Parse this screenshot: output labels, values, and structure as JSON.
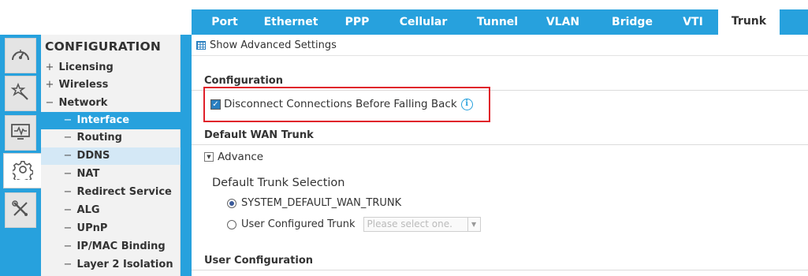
{
  "tabs": [
    {
      "label": "Port",
      "active": false
    },
    {
      "label": "Ethernet",
      "active": false
    },
    {
      "label": "PPP",
      "active": false
    },
    {
      "label": "Cellular",
      "active": false
    },
    {
      "label": "Tunnel",
      "active": false
    },
    {
      "label": "VLAN",
      "active": false
    },
    {
      "label": "Bridge",
      "active": false
    },
    {
      "label": "VTI",
      "active": false
    },
    {
      "label": "Trunk",
      "active": true
    }
  ],
  "rail": {
    "icons": [
      "dashboard-icon",
      "monitor-wand-icon",
      "activity-monitor-icon",
      "configuration-gear-icon",
      "maintenance-tools-icon"
    ],
    "active": "configuration-gear-icon"
  },
  "nav": {
    "title": "CONFIGURATION",
    "items": [
      {
        "symbol": "+",
        "label": "Licensing"
      },
      {
        "symbol": "+",
        "label": "Wireless"
      },
      {
        "symbol": "−",
        "label": "Network"
      },
      {
        "symbol": "−",
        "label": "Interface"
      },
      {
        "symbol": "−",
        "label": "Routing"
      },
      {
        "symbol": "−",
        "label": "DDNS"
      },
      {
        "symbol": "−",
        "label": "NAT"
      },
      {
        "symbol": "−",
        "label": "Redirect Service"
      },
      {
        "symbol": "−",
        "label": "ALG"
      },
      {
        "symbol": "−",
        "label": "UPnP"
      },
      {
        "symbol": "−",
        "label": "IP/MAC Binding"
      },
      {
        "symbol": "−",
        "label": "Layer 2 Isolation"
      }
    ],
    "selected": "Interface",
    "hovered": "DDNS"
  },
  "main": {
    "show_advanced_label": "Show Advanced Settings",
    "configuration_title": "Configuration",
    "disconnect_label": "Disconnect Connections Before Falling Back",
    "disconnect_checked": true,
    "info_glyph": "i",
    "default_wan_title": "Default WAN Trunk",
    "advance_label": "Advance",
    "default_trunk_selection_title": "Default Trunk Selection",
    "radio_system_label": "SYSTEM_DEFAULT_WAN_TRUNK",
    "radio_user_label": "User Configured Trunk",
    "select_placeholder": "Please select one.",
    "user_configuration_title": "User Configuration"
  },
  "colors": {
    "accent": "#27a1dd",
    "highlight_border": "#e0202a"
  }
}
